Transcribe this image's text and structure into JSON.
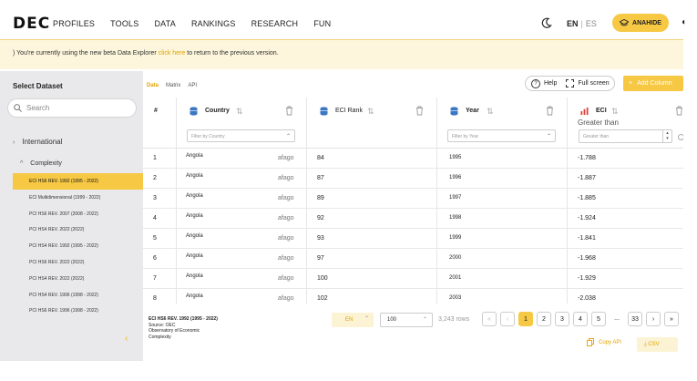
{
  "nav": {
    "logo": "DEC",
    "items": [
      "PROFILES",
      "TOOLS",
      "DATA",
      "RANKINGS",
      "RESEARCH",
      "FUN"
    ],
    "lang_en": "EN",
    "lang_sep": "|",
    "lang_es": "ES",
    "user": "ANAHIDE"
  },
  "banner": {
    "prefix": ") You're currently using the new beta Data Explorer",
    "link": "click here",
    "suffix": "to return to the previous version."
  },
  "sidebar": {
    "title": "Select Dataset",
    "search_placeholder": "Search",
    "group": "International",
    "subgroup": "Complexity",
    "datasets": [
      "ECI HS6 REV. 1992 (1995 - 2022)",
      "ECI Multidimensional (1999 - 2022)",
      "PCI HS6 REV. 2007 (2008 - 2022)",
      "PCI HS4 REV. 2022 (2022)",
      "PCI HS4 REV. 1992 (1995 - 2022)",
      "PCI HS6 REV. 2022 (2022)",
      "PCI HS4 REV. 2022 (2022)",
      "PCI HS4 REV. 1996 (1998 - 2022)",
      "PCI HS6 REV. 1996 (1998 - 2022)"
    ],
    "active_index": 0
  },
  "tabs": [
    "Data",
    "Matrix",
    "API"
  ],
  "toolbar": {
    "help": "Help",
    "fullscreen": "Full screen",
    "add_column": "Add Column"
  },
  "table": {
    "columns": {
      "index": "#",
      "country": "Country",
      "rank": "ECI Rank",
      "year": "Year",
      "eci": "ECI"
    },
    "filters": {
      "country": "Filter by Country",
      "year": "Filter by Year",
      "eci_label": "Greater than",
      "eci_placeholder": "Greater than"
    },
    "rows": [
      {
        "idx": "1",
        "country": "Angola",
        "id": "afago",
        "rank": "84",
        "year": "1995",
        "eci": "-1.788"
      },
      {
        "idx": "2",
        "country": "Angola",
        "id": "afago",
        "rank": "87",
        "year": "1996",
        "eci": "-1.887"
      },
      {
        "idx": "3",
        "country": "Angola",
        "id": "afago",
        "rank": "89",
        "year": "1997",
        "eci": "-1.885"
      },
      {
        "idx": "4",
        "country": "Angola",
        "id": "afago",
        "rank": "92",
        "year": "1998",
        "eci": "-1.924"
      },
      {
        "idx": "5",
        "country": "Angola",
        "id": "afago",
        "rank": "93",
        "year": "1999",
        "eci": "-1.841"
      },
      {
        "idx": "6",
        "country": "Angola",
        "id": "afago",
        "rank": "97",
        "year": "2000",
        "eci": "-1.968"
      },
      {
        "idx": "7",
        "country": "Angola",
        "id": "afago",
        "rank": "100",
        "year": "2001",
        "eci": "-1.929"
      },
      {
        "idx": "8",
        "country": "Angola",
        "id": "afago",
        "rank": "102",
        "year": "2003",
        "eci": "-2.038"
      }
    ]
  },
  "footer": {
    "dataset": "ECI HS6 REV. 1992 (1995 - 2022)",
    "source_line": "Source: OEC",
    "org_line1": "Observatory of Economic",
    "org_line2": "Complexity",
    "lang": "EN",
    "rows_per_page": "100",
    "row_count": "3,243 rows",
    "pages": [
      "1",
      "2",
      "3",
      "4",
      "5",
      "...",
      "33"
    ],
    "copy_api": "Copy API",
    "csv": "CSV"
  },
  "colors": {
    "accent": "#f6c843",
    "banner_bg": "#fdf6dc",
    "sidebar_bg": "#e9e9eb"
  }
}
